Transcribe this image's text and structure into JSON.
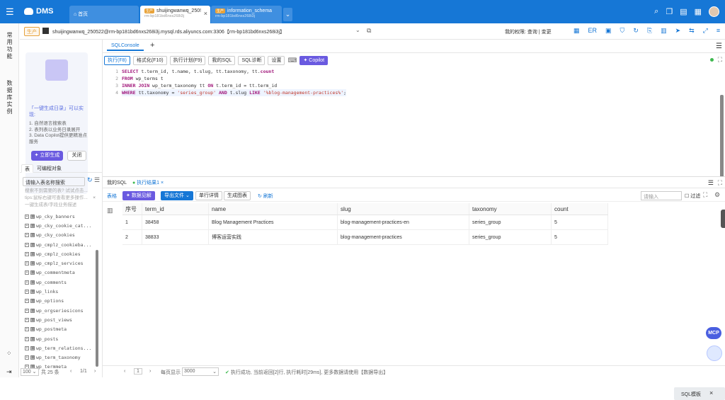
{
  "topbar": {
    "app_name": "DMS",
    "tabs": [
      {
        "label": "首页"
      },
      {
        "label": "shuijingwanwq_250!",
        "sub": "rm-bp181bd6nxs268i3j",
        "tag": "生产"
      },
      {
        "label": "information_schema",
        "sub": "rm-bp181bd6nxs268i3j",
        "tag": "生产"
      }
    ]
  },
  "leftnav": {
    "item1": "常用功能",
    "item2": "数据库实例"
  },
  "connection": {
    "env": "生产",
    "string": "shuijingwanwq_250522@rm-bp181bd6nxs268i3j.mysql.rds.aliyuncs.com:3306【rm-bp181bd6nxs268i3j】",
    "permission": "我的权限: 查询 | 变更"
  },
  "promo": {
    "title": "「一键生成日录」可以实现:",
    "items": [
      "1. 自然语言搜索表",
      "2. 表列表以业务日录展开",
      "3. Data Copilot提供更精准点服务"
    ],
    "generate_label": "立即生成",
    "close_label": "关闭"
  },
  "left_panel": {
    "tab_table": "表",
    "tab_prog": "可编程对象",
    "search_placeholder": "请输入表名称搜索",
    "hint1": "搜索不到需要的表? 试试点击...",
    "hint2": "tips:鼠标右键可查看更多操作...",
    "hint3": "一键生成表/字段业务描述",
    "tables": [
      "wp_cky_banners",
      "wp_cky_cookie_cat...",
      "wp_cky_cookies",
      "wp_cmplz_cookieba...",
      "wp_cmplz_cookies",
      "wp_cmplz_services",
      "wp_commentmeta",
      "wp_comments",
      "wp_links",
      "wp_options",
      "wp_orgseriesicons",
      "wp_post_views",
      "wp_postmeta",
      "wp_posts",
      "wp_term_relations...",
      "wp_term_taxonomy",
      "wp_termmeta"
    ],
    "page_size": "100",
    "total": "共 25 条",
    "page": "1/1"
  },
  "editor": {
    "tab": "SQLConsole",
    "toolbar": [
      "执行(F8)",
      "格式化(F10)",
      "执行计划(F9)",
      "我的SQL",
      "SQL诊断",
      "设置"
    ],
    "copilot": "Copilot",
    "lines": [
      "SELECT t.term_id, t.name, t.slug, tt.taxonomy, tt.count",
      "FROM wp_terms t",
      "INNER JOIN wp_term_taxonomy tt ON t.term_id = tt.term_id",
      "WHERE tt.taxonomy = 'series_group' AND t.slug LIKE '%blog-management-practices%';"
    ]
  },
  "results": {
    "tab_mysql": "我的SQL",
    "tab_result": "执行结果1",
    "btn_table": "表格",
    "btn_visual": "数据见解",
    "btn_export": "导出文件",
    "btn_single": "单行详情",
    "btn_chart": "生成图表",
    "btn_refresh": "刷新",
    "filter_placeholder": "请输入",
    "filter_label": "过滤",
    "columns": [
      "序号",
      "term_id",
      "name",
      "slug",
      "taxonomy",
      "count"
    ],
    "rows": [
      [
        "1",
        "38458",
        "Blog Management Practices",
        "blog-management-practices-en",
        "series_group",
        "5"
      ],
      [
        "2",
        "38833",
        "博客运营实践",
        "blog-management-practices",
        "series_group",
        "5"
      ]
    ],
    "template_label": "SQL模板",
    "footer_page": "1",
    "footer_perpage_label": "每页显示",
    "footer_perpage": "3000",
    "status": "执行成功, 当前返回[2]行, 执行耗时[29ms], 更多数据请使用【数据导出】"
  },
  "mcp_label": "MCP"
}
